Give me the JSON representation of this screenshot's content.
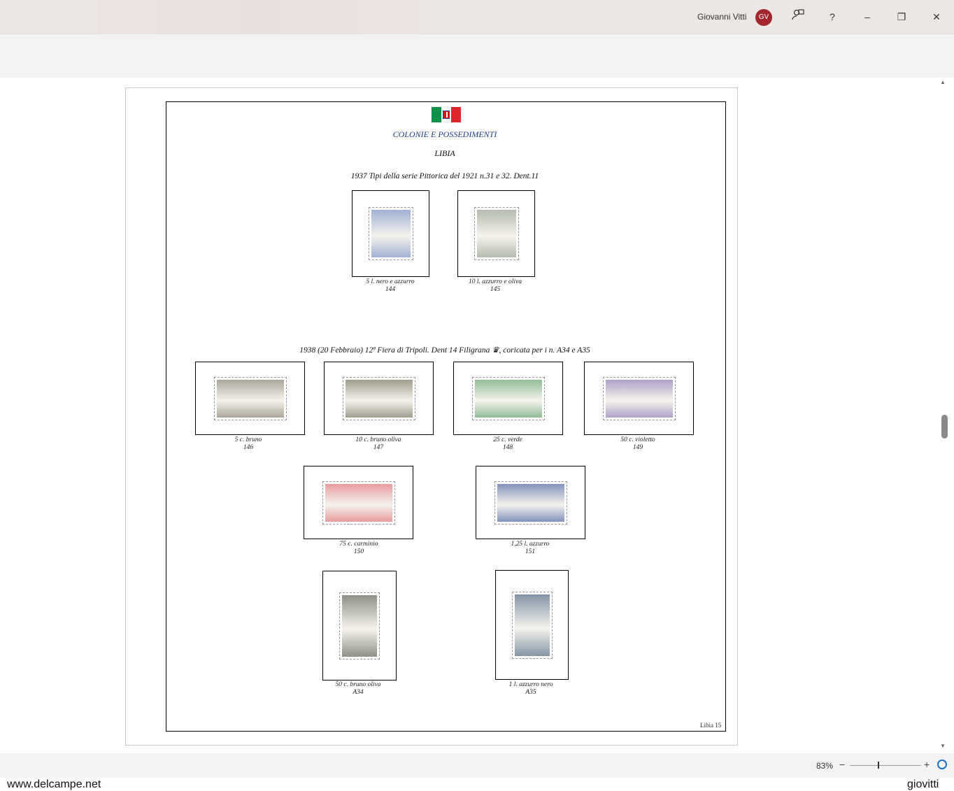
{
  "titlebar": {
    "user_name": "Giovanni Vitti",
    "avatar_initials": "GV",
    "feedback_icon": "feedback-icon",
    "help_label": "?",
    "minimize_label": "–",
    "restore_label": "❐",
    "close_label": "✕"
  },
  "document": {
    "header": "COLONIE E POSSEDIMENTI",
    "country": "LIBIA",
    "section1_title": "1937 Tipi della serie Pittorica del 1921 n.31 e 32. Dent.11",
    "section2_title": "1938 (20 Febbraio) 12ª Fiera di Tripoli. Dent 14 Filigrana ♛, coricata per i n. A34 e A35",
    "page_number": "Libia 15",
    "stamps": [
      {
        "desc": "5 l. nero e azzurro",
        "num": "144",
        "color": "#8fa3cf"
      },
      {
        "desc": "10 l. azzurro e oliva",
        "num": "145",
        "color": "#a9b0a0"
      },
      {
        "desc": "5 c. bruno",
        "num": "146",
        "color": "#9c9688"
      },
      {
        "desc": "10 c. bruno oliva",
        "num": "147",
        "color": "#8d8c78"
      },
      {
        "desc": "25 c. verde",
        "num": "148",
        "color": "#7cb184"
      },
      {
        "desc": "50 c. violetto",
        "num": "149",
        "color": "#a08fc0"
      },
      {
        "desc": "75 c. carminio",
        "num": "150",
        "color": "#e58a8c"
      },
      {
        "desc": "1,25 l. azzurro",
        "num": "151",
        "color": "#6c7fb3"
      },
      {
        "desc": "50 c. bruno oliva",
        "num": "A34",
        "color": "#7a7d70"
      },
      {
        "desc": "1 l. azzurro nero",
        "num": "A35",
        "color": "#6e8296"
      }
    ]
  },
  "status": {
    "zoom": "83%",
    "zoom_minus": "−",
    "zoom_plus": "+"
  },
  "watermark": {
    "left": "www.delcampe.net",
    "right": "giovitti"
  },
  "colors": {
    "header_blue": "#1f3e8c",
    "avatar_red": "#a4262c"
  }
}
